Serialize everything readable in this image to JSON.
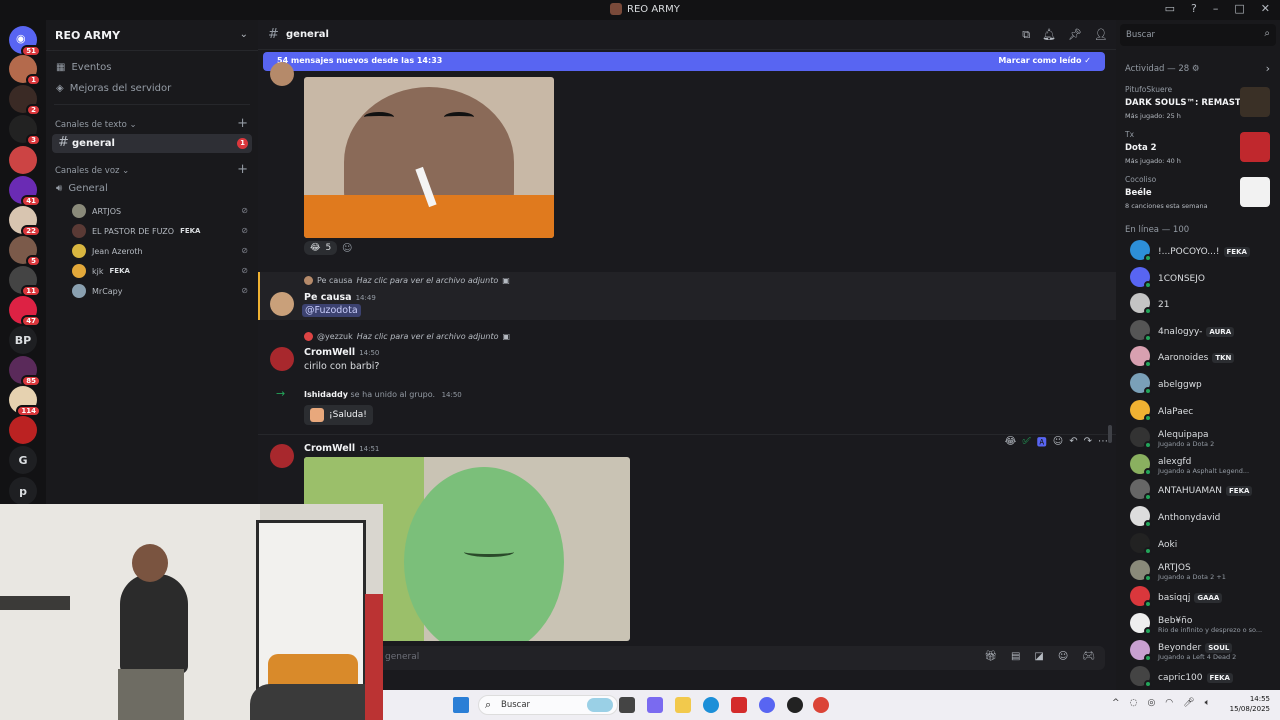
{
  "window": {
    "title": "REO ARMY"
  },
  "rail": {
    "home_badge": "51",
    "servers": [
      {
        "badge": "1",
        "color": "#b46a4c"
      },
      {
        "badge": "2",
        "color": "#3a2a25"
      },
      {
        "badge": "3",
        "color": "#222"
      },
      {
        "badge": "",
        "color": "#c44"
      },
      {
        "badge": "41",
        "color": "#6a2bb4"
      },
      {
        "badge": "22",
        "color": "#d8c5b0"
      },
      {
        "badge": "5",
        "color": "#7b5a4a"
      },
      {
        "badge": "11",
        "color": "#444"
      },
      {
        "badge": "47",
        "color": "#d24"
      },
      {
        "badge": "85",
        "color": "#5a2a5a"
      },
      {
        "badge": "114",
        "color": "#e6d2b0"
      },
      {
        "badge": "",
        "color": "#b22"
      }
    ],
    "text_servers": [
      "BP",
      "G",
      "p"
    ]
  },
  "sidebar": {
    "server_name": "REO ARMY",
    "nav": [
      {
        "label": "Eventos",
        "icon": "calendar-icon"
      },
      {
        "label": "Mejoras del servidor",
        "icon": "boost-icon"
      }
    ],
    "text_category": "Canales de texto",
    "text_channel": {
      "name": "general",
      "unread": "1"
    },
    "voice_category": "Canales de voz",
    "voice_channel": "General",
    "voice_users": [
      {
        "name": "ARTJOS",
        "tag": "",
        "color": "#8a8a7a"
      },
      {
        "name": "EL PASTOR DE FUZO",
        "tag": "FEKA",
        "color": "#5a3a35"
      },
      {
        "name": "Jean Azeroth",
        "tag": "",
        "color": "#d9b640"
      },
      {
        "name": "kjk",
        "tag": "FEKA",
        "color": "#e2a83a"
      },
      {
        "name": "MrCapy",
        "tag": "",
        "color": "#8aa0b0"
      }
    ]
  },
  "chat": {
    "channel": "general",
    "new_messages": "54 mensajes nuevos desde las 14:33",
    "mark_read": "Marcar como leído",
    "reaction_count": "5",
    "msg1": {
      "reply_user": "Pe causa",
      "reply_text": "Haz clic para ver el archivo adjunto",
      "author": "Pe causa",
      "time": "14:49",
      "mention": "@Fuzodota"
    },
    "msg2": {
      "reply_user": "@yezzuk",
      "reply_text": "Haz clic para ver el archivo adjunto",
      "author": "CromWell",
      "time": "14:50",
      "text": "cirilo con barbi?"
    },
    "join": {
      "user": "Ishidaddy",
      "text": "se ha unido al grupo.",
      "time": "14:50",
      "button": "¡Saluda!"
    },
    "msg3": {
      "author": "CromWell",
      "time": "14:51"
    },
    "input_placeholder": "general"
  },
  "members": {
    "search_placeholder": "Buscar",
    "activity_header": "Actividad — 28",
    "activities": [
      {
        "user": "PitufoSkuere",
        "game": "DARK SOULS™: REMASTE...",
        "sub": "Más jugado: 25 h",
        "color": "#3a3026"
      },
      {
        "user": "Tx",
        "game": "Dota 2",
        "sub": "Más jugado: 40 h",
        "color": "#c0282d"
      },
      {
        "user": "Cocoliso",
        "game": "Beéle",
        "sub": "8 canciones esta semana",
        "color": "#f2f2f2"
      }
    ],
    "online_header": "En línea — 100",
    "list": [
      {
        "name": "!...POCOYO...!",
        "tag": "FEKA",
        "status": "",
        "color": "#2d8fd8"
      },
      {
        "name": "1CONSEJO",
        "tag": "",
        "status": "",
        "color": "#5865f2"
      },
      {
        "name": "21",
        "tag": "",
        "status": "",
        "color": "#c4c4c4"
      },
      {
        "name": "4nalogyy-",
        "tag": "AURA",
        "status": "",
        "color": "#555"
      },
      {
        "name": "Aaronoides",
        "tag": "TKN",
        "status": "",
        "color": "#d8a0b0"
      },
      {
        "name": "abelggwp",
        "tag": "",
        "status": "",
        "color": "#7aa0b8"
      },
      {
        "name": "AlaPaec",
        "tag": "",
        "status": "",
        "color": "#f0b232"
      },
      {
        "name": "Alequipapa",
        "tag": "",
        "status": "Jugando a Dota 2",
        "color": "#333"
      },
      {
        "name": "alexgfd",
        "tag": "",
        "status": "Jugando a Asphalt Legend...",
        "color": "#8ab060"
      },
      {
        "name": "ANTAHUAMAN",
        "tag": "FEKA",
        "status": "",
        "color": "#666"
      },
      {
        "name": "Anthonydavid",
        "tag": "",
        "status": "",
        "color": "#ddd"
      },
      {
        "name": "Aoki",
        "tag": "",
        "status": "",
        "color": "#222"
      },
      {
        "name": "ARTJOS",
        "tag": "",
        "status": "Jugando a Dota 2 +1",
        "color": "#8a8a7a"
      },
      {
        "name": "basiqqj",
        "tag": "GAAA",
        "status": "",
        "color": "#da373c"
      },
      {
        "name": "Beb¥ño",
        "tag": "",
        "status": "Rio de infinito y desprezo o so...",
        "color": "#eee"
      },
      {
        "name": "Beyonder",
        "tag": "SOUL",
        "status": "Jugando a Left 4 Dead 2",
        "color": "#c8a0d0"
      },
      {
        "name": "capric100",
        "tag": "FEKA",
        "status": "",
        "color": "#444"
      }
    ]
  },
  "taskbar": {
    "search_placeholder": "Buscar",
    "time": "14:55",
    "date": "15/08/2025"
  }
}
